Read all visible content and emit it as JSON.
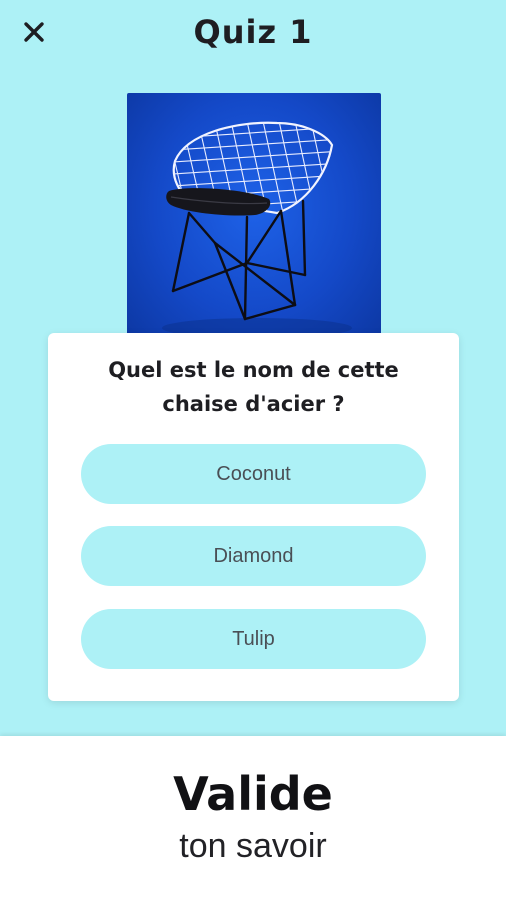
{
  "header": {
    "title": "Quiz 1",
    "close_icon": "close-icon"
  },
  "image": {
    "subject": "chair-image"
  },
  "question": {
    "text": "Quel est le nom de cette chaise d'acier ?",
    "options": [
      {
        "label": "Coconut"
      },
      {
        "label": "Diamond"
      },
      {
        "label": "Tulip"
      }
    ]
  },
  "footer": {
    "main": "Valide",
    "sub": "ton savoir"
  },
  "colors": {
    "background": "#adf1f6",
    "option_bg": "#adf1f6",
    "card": "#ffffff",
    "title_text": "#1e1e22",
    "photo_bg": "#1449c8"
  }
}
